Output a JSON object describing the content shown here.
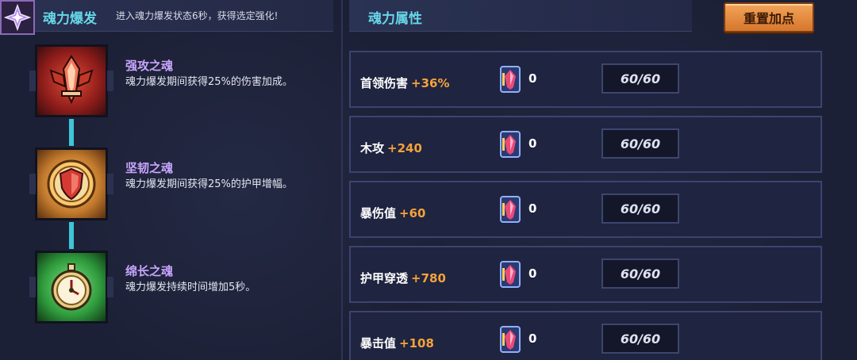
{
  "burst": {
    "icon": "soul-burst-icon",
    "title": "魂力爆发",
    "description": "进入魂力爆发状态6秒，获得选定强化!"
  },
  "attributes_panel": {
    "title": "魂力属性",
    "reset_label": "重置加点"
  },
  "talents": [
    {
      "name": "强攻之魂",
      "description": "魂力爆发期间获得25%的伤害加成。",
      "icon": "red-attack-soul-icon",
      "color": "#c63a2a"
    },
    {
      "name": "坚韧之魂",
      "description": "魂力爆发期间获得25%的护甲增幅。",
      "icon": "shield-soul-icon",
      "color": "#d9892f"
    },
    {
      "name": "绵长之魂",
      "description": "魂力爆发持续时间增加5秒。",
      "icon": "clock-soul-icon",
      "color": "#3bb34a"
    }
  ],
  "attributes": [
    {
      "label": "首领伤害",
      "bonus": "+36%",
      "gem_count": "0",
      "level": "60/60"
    },
    {
      "label": "木攻",
      "bonus": "+240",
      "gem_count": "0",
      "level": "60/60"
    },
    {
      "label": "暴伤值",
      "bonus": "+60",
      "gem_count": "0",
      "level": "60/60"
    },
    {
      "label": "护甲穿透",
      "bonus": "+780",
      "gem_count": "0",
      "level": "60/60"
    },
    {
      "label": "暴击值",
      "bonus": "+108",
      "gem_count": "0",
      "level": "60/60"
    }
  ],
  "colors": {
    "accent_cyan": "#66d6e8",
    "talent_name": "#c9a6ff",
    "bonus_orange": "#f5a23a",
    "button_orange": "#e08a3c"
  }
}
